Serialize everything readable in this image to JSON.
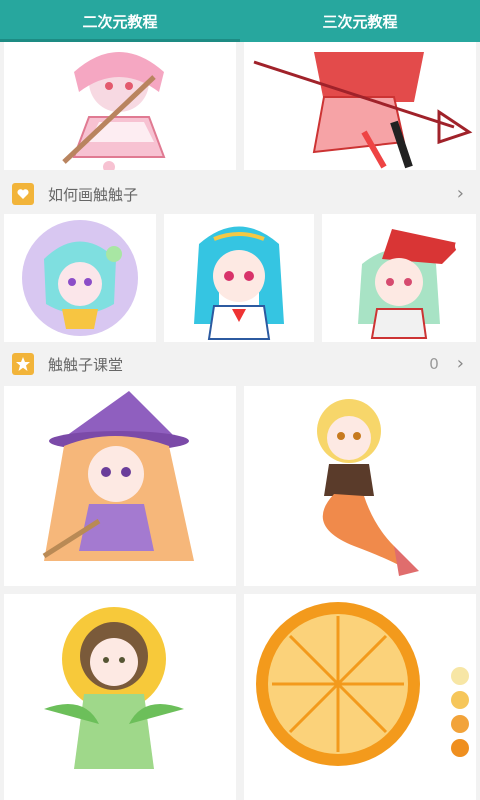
{
  "tabs": [
    {
      "label": "二次元教程"
    },
    {
      "label": "三次元教程"
    }
  ],
  "sections": {
    "howto": {
      "title": "如何画触触子",
      "icon": "heart-icon"
    },
    "classroom": {
      "title": "触触子课堂",
      "count": "0",
      "icon": "star-icon"
    }
  },
  "colors": {
    "accent": "#27a79e",
    "badge": "#f2b43a"
  }
}
